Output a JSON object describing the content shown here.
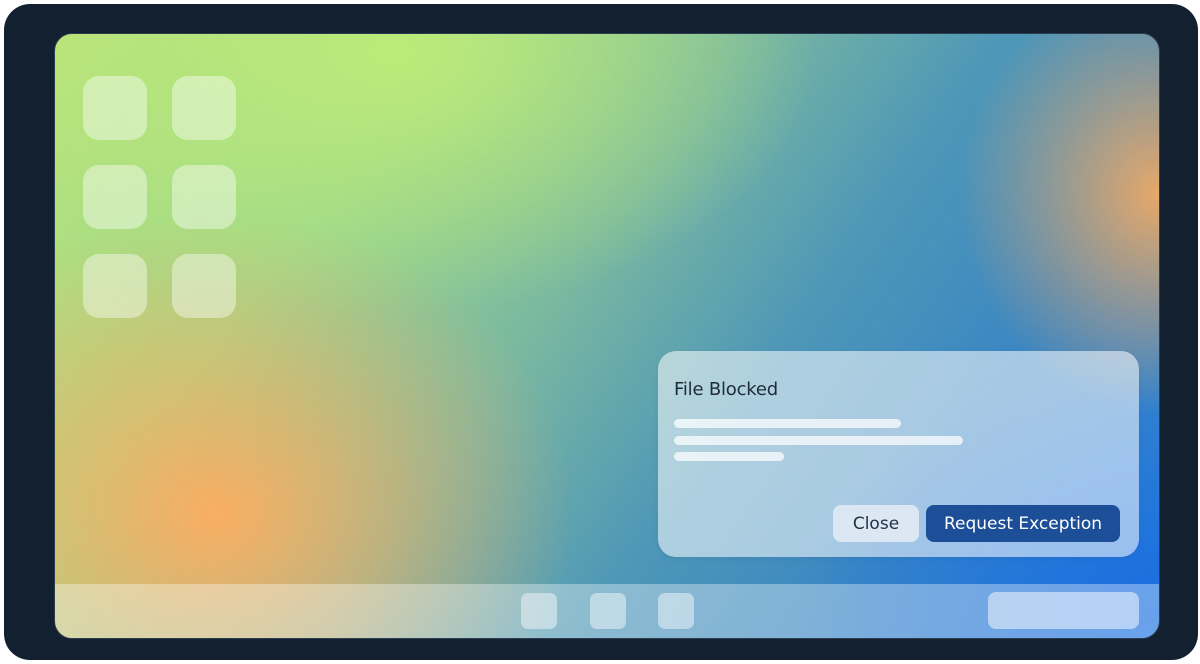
{
  "dialog": {
    "title": "File Blocked",
    "close_label": "Close",
    "request_label": "Request Exception"
  },
  "desktop": {
    "icon_count": 6
  },
  "taskbar": {
    "app_count": 3
  },
  "colors": {
    "bezel": "#13202f",
    "primary_button": "#1c4f98",
    "secondary_button": "#dbe8f4"
  }
}
